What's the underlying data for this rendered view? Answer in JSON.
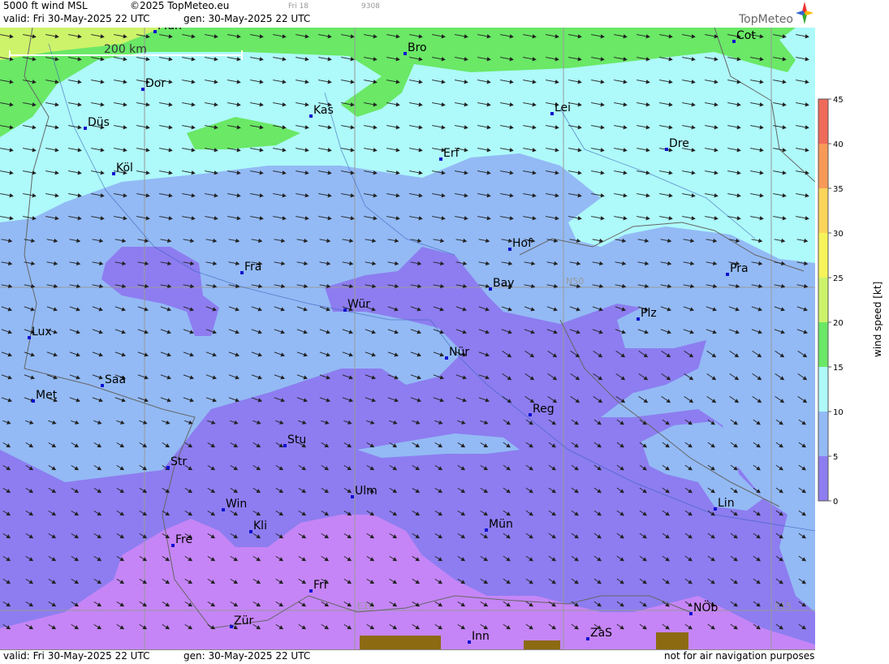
{
  "header": {
    "title": "5000 ft wind MSL",
    "copyright": "©2025 TopMeteo.eu",
    "day_tag": "Fri 18",
    "code": "9308",
    "valid": "valid:  Fri  30-May-2025  22 UTC",
    "gen": "gen:  30-May-2025  22 UTC",
    "brand": "TopMeteo"
  },
  "footer": {
    "valid": "valid:  Fri  30-May-2025  22 UTC",
    "gen": "gen:  30-May-2025  22 UTC",
    "disclaimer": "not for air navigation purposes"
  },
  "map": {
    "scale_label": "200 km",
    "grid_labels": {
      "n50": "N50",
      "e10": "E10",
      "e15": "E15"
    },
    "wind_direction": "west-northwest to east-southeast arrows",
    "cities": [
      {
        "name": "Mün",
        "role": "north-top"
      },
      {
        "name": "Bro"
      },
      {
        "name": "Cot"
      },
      {
        "name": "Dor"
      },
      {
        "name": "Kas"
      },
      {
        "name": "Düs"
      },
      {
        "name": "Lei"
      },
      {
        "name": "Dre"
      },
      {
        "name": "Erf"
      },
      {
        "name": "Köl"
      },
      {
        "name": "Hof"
      },
      {
        "name": "Fra"
      },
      {
        "name": "Pra"
      },
      {
        "name": "Bay"
      },
      {
        "name": "Wür"
      },
      {
        "name": "Plz"
      },
      {
        "name": "Lux"
      },
      {
        "name": "Nür"
      },
      {
        "name": "Saa"
      },
      {
        "name": "Met"
      },
      {
        "name": "Reg"
      },
      {
        "name": "Stu"
      },
      {
        "name": "Str"
      },
      {
        "name": "Ulm"
      },
      {
        "name": "Lin"
      },
      {
        "name": "Win"
      },
      {
        "name": "Kli"
      },
      {
        "name": "Mün"
      },
      {
        "name": "Fre"
      },
      {
        "name": "Fri"
      },
      {
        "name": "NÖb"
      },
      {
        "name": "Zür"
      },
      {
        "name": "ZaS"
      },
      {
        "name": "Inn"
      }
    ]
  },
  "legend": {
    "title": "wind speed [kt]",
    "ticks": [
      "45",
      "40",
      "35",
      "30",
      "25",
      "20",
      "15",
      "10",
      "5",
      "0"
    ],
    "colors": [
      "#f06a5a",
      "#f79a58",
      "#fbd45a",
      "#f6f45a",
      "#cdf36a",
      "#6ae866",
      "#aef9fa",
      "#93baf5",
      "#8d7df0",
      "#c585f6"
    ]
  },
  "colors": {
    "band_0_5": "#c585f6",
    "band_5_10": "#8d7df0",
    "band_10_15": "#93baf5",
    "band_15_20": "#aef9fa",
    "band_20_25": "#6ae866",
    "terrain": "#8c6a12",
    "city_marker": "#1010d0"
  }
}
